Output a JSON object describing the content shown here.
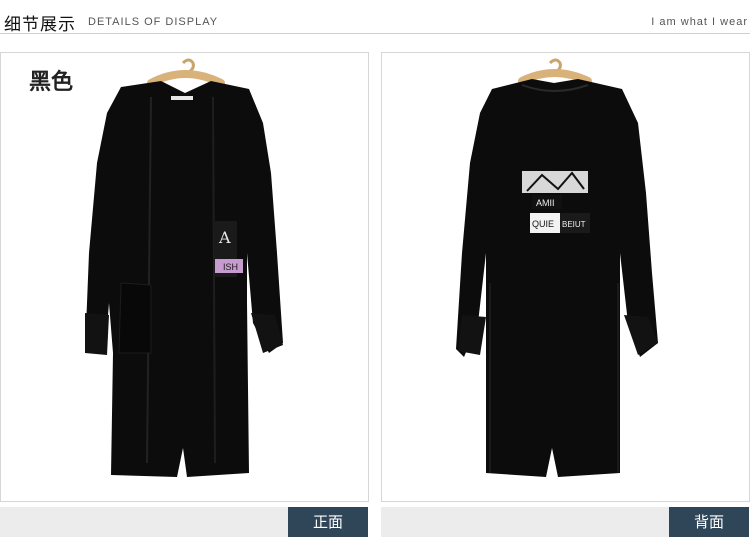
{
  "header": {
    "title_cn": "细节展示",
    "title_en": "DETAILS OF DISPLAY",
    "right_text": "I am what I wear"
  },
  "front": {
    "color_label": "黑色",
    "caption": "正面",
    "print_text": [
      "A",
      "ISH"
    ]
  },
  "back": {
    "caption": "背面",
    "print_text": [
      "AMII",
      "QUIE",
      "BEIUT"
    ]
  },
  "colors": {
    "garment": "#0c0c0c",
    "caption_tag": "#2f4558",
    "caption_bar": "#ececec"
  }
}
